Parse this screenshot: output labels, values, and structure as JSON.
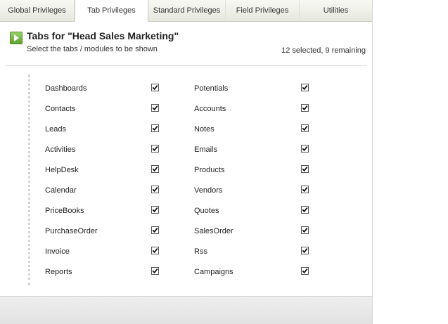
{
  "tabs": [
    {
      "label": "Global Privileges"
    },
    {
      "label": "Tab Privileges"
    },
    {
      "label": "Standard Privileges"
    },
    {
      "label": "Field Privileges"
    },
    {
      "label": "Utilities"
    }
  ],
  "active_tab": "Tab Privileges",
  "header": {
    "title": "Tabs for \"Head Sales Marketing\"",
    "subtitle": "Select the tabs / modules to be shown",
    "count": "12 selected, 9 remaining"
  },
  "modules": [
    {
      "left": {
        "label": "Dashboards",
        "checked": true
      },
      "right": {
        "label": "Potentials",
        "checked": true
      }
    },
    {
      "left": {
        "label": "Contacts",
        "checked": true
      },
      "right": {
        "label": "Accounts",
        "checked": true
      }
    },
    {
      "left": {
        "label": "Leads",
        "checked": true
      },
      "right": {
        "label": "Notes",
        "checked": true
      }
    },
    {
      "left": {
        "label": "Activities",
        "checked": true
      },
      "right": {
        "label": "Emails",
        "checked": true
      }
    },
    {
      "left": {
        "label": "HelpDesk",
        "checked": true
      },
      "right": {
        "label": "Products",
        "checked": true
      }
    },
    {
      "left": {
        "label": "Calendar",
        "checked": true
      },
      "right": {
        "label": "Vendors",
        "checked": true
      }
    },
    {
      "left": {
        "label": "PriceBooks",
        "checked": true
      },
      "right": {
        "label": "Quotes",
        "checked": true
      }
    },
    {
      "left": {
        "label": "PurchaseOrder",
        "checked": true
      },
      "right": {
        "label": "SalesOrder",
        "checked": true
      }
    },
    {
      "left": {
        "label": "Invoice",
        "checked": true
      },
      "right": {
        "label": "Rss",
        "checked": true
      }
    },
    {
      "left": {
        "label": "Reports",
        "checked": true
      },
      "right": {
        "label": "Campaigns",
        "checked": true
      }
    }
  ],
  "colors": {
    "accent_green": "#5aa22a",
    "tabbar_bg": "#e6e8df",
    "footer_bg": "#e2e2e2"
  }
}
